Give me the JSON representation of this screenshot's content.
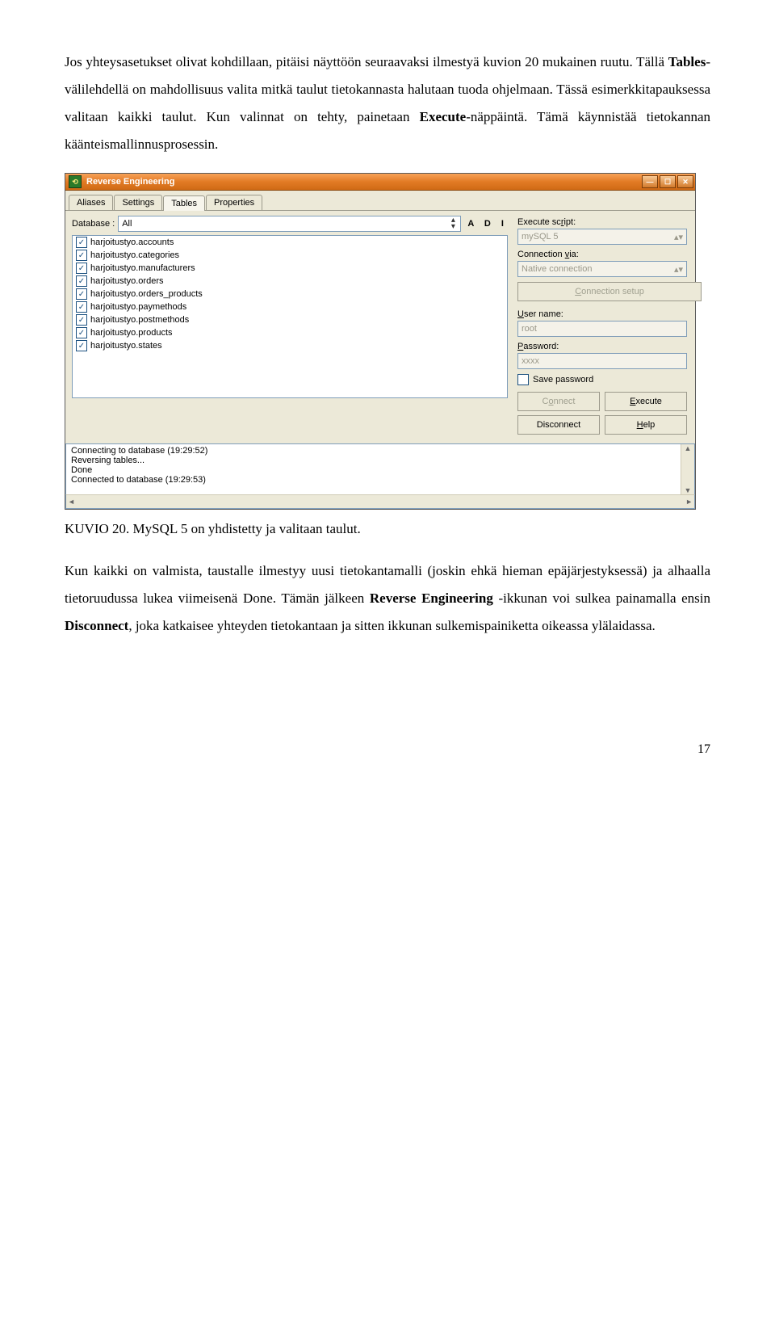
{
  "para1_pre": "Jos yhteysasetukset olivat kohdillaan, pitäisi näyttöön seuraavaksi ilmestyä kuvion 20 mukainen ruutu. Tällä ",
  "para1_bold1": "Tables",
  "para1_mid": "-välilehdellä on mahdollisuus valita mitkä taulut tietokannasta halutaan tuoda ohjelmaan. Tässä esimerkkitapauksessa valitaan kaikki taulut. Kun valinnat on tehty, painetaan ",
  "para1_bold2": "Execute",
  "para1_post": "-näppäintä. Tämä käynnistää tietokannan käänteismallinnusprosessin.",
  "caption": "KUVIO 20. MySQL 5 on yhdistetty ja valitaan taulut.",
  "para2_pre": "Kun kaikki on valmista, taustalle ilmestyy uusi tietokantamalli (joskin ehkä hieman epäjärjestyksessä) ja alhaalla tietoruudussa lukea viimeisenä Done. Tämän jälkeen ",
  "para2_bold1": "Reverse Engineering",
  "para2_mid": " -ikkunan voi sulkea painamalla ensin ",
  "para2_bold2": "Disconnect",
  "para2_post": ", joka katkaisee yhteyden tietokantaan ja sitten ikkunan sulkemispainiketta oikeassa ylälaidassa.",
  "page_number": "17",
  "win": {
    "title": "Reverse Engineering",
    "tabs": {
      "t0": "Aliases",
      "t1": "Settings",
      "t2": "Tables",
      "t3": "Properties"
    },
    "db_label": "Database :",
    "db_value": "All",
    "adi": "A  D  I",
    "tables": {
      "i0": "harjoitustyo.accounts",
      "i1": "harjoitustyo.categories",
      "i2": "harjoitustyo.manufacturers",
      "i3": "harjoitustyo.orders",
      "i4": "harjoitustyo.orders_products",
      "i5": "harjoitustyo.paymethods",
      "i6": "harjoitustyo.postmethods",
      "i7": "harjoitustyo.products",
      "i8": "harjoitustyo.states"
    },
    "right": {
      "exec_label": "Execute script:",
      "exec_value": "mySQL 5",
      "conn_label": "Connection via:",
      "conn_value": "Native connection",
      "conn_setup": "Connection setup",
      "user_label": "User name:",
      "user_value": "root",
      "pass_label": "Password:",
      "pass_value": "xxxx",
      "save_pw": "Save password",
      "connect": "Connect",
      "execute": "Execute",
      "disconnect": "Disconnect",
      "help": "Help"
    },
    "log": {
      "l0": "Connecting to database (19:29:52)",
      "l1": "Reversing tables...",
      "l2": "Done",
      "l3": "Connected to database (19:29:53)"
    }
  }
}
